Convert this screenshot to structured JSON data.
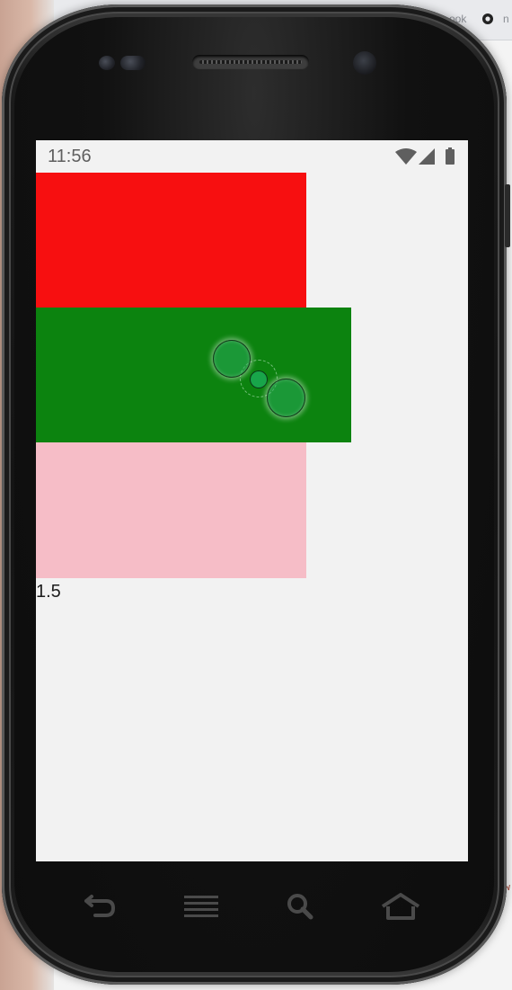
{
  "statusbar": {
    "time": "11:56",
    "icons": [
      "wifi-icon",
      "cell-signal-icon",
      "battery-icon"
    ]
  },
  "content": {
    "red_color": "#f70f10",
    "green_color": "#0c830f",
    "pink_color": "#f6bdc7",
    "value_text": "1.5"
  },
  "device": {
    "nav_keys": [
      "back-icon",
      "menu-icon",
      "search-icon",
      "home-icon"
    ]
  },
  "background_app": {
    "tab_text_fragment": "ook",
    "tab_text_fragment_2": "n",
    "edge_text": "w"
  }
}
